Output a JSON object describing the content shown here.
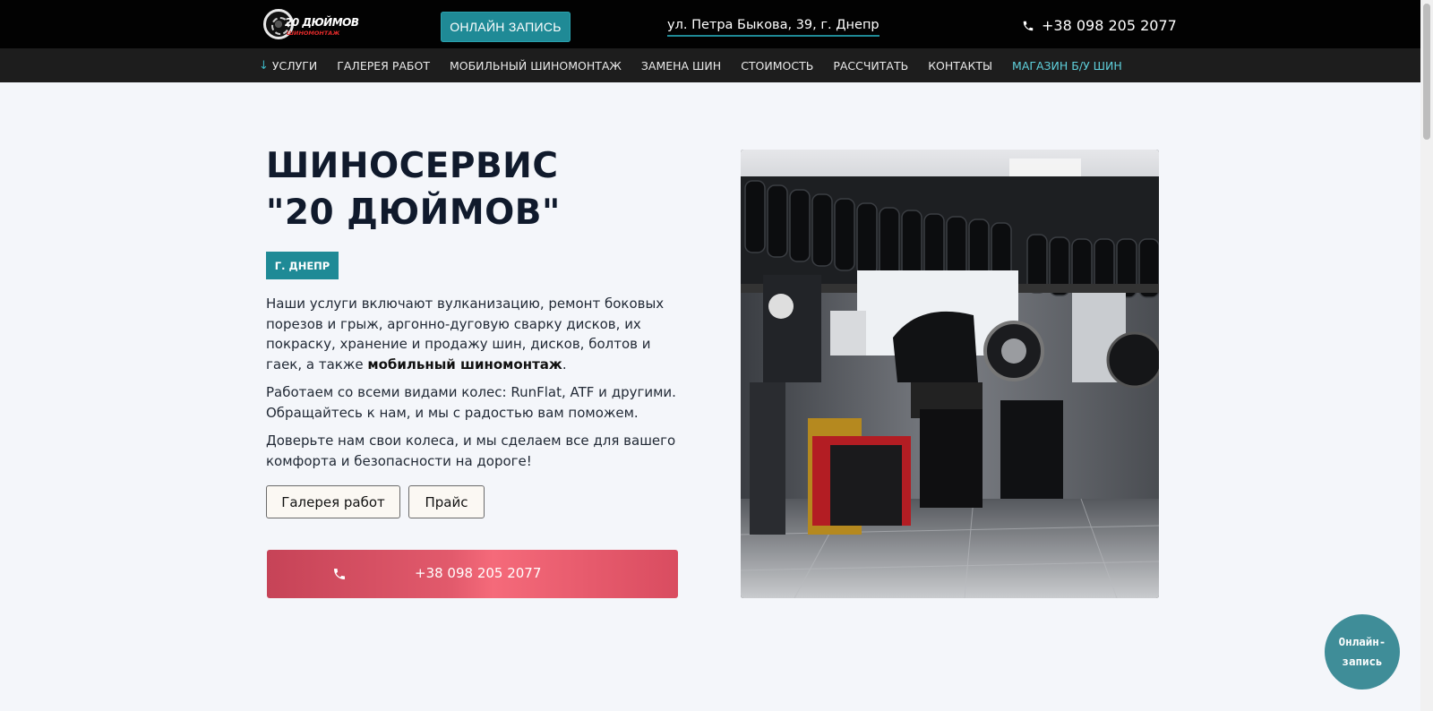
{
  "header": {
    "logo_line1": "20 ДЮЙМОВ",
    "logo_line2": "ШИНОМОНТАЖ",
    "book_button": "ОНЛАЙН ЗАПИСЬ",
    "address": "ул. Петра Быкова, 39, г. Днепр",
    "phone": "+38 098 205 2077",
    "accent_color": "#1f8a96"
  },
  "nav": {
    "items": [
      {
        "label": "УСЛУГИ",
        "icon": "arrow-down-icon"
      },
      {
        "label": "ГАЛЕРЕЯ РАБОТ"
      },
      {
        "label": "МОБИЛЬНЫЙ ШИНОМОНТАЖ"
      },
      {
        "label": "ЗАМЕНА ШИН"
      },
      {
        "label": "СТОИМОСТЬ"
      },
      {
        "label": "РАССЧИТАТЬ"
      },
      {
        "label": "КОНТАКТЫ"
      },
      {
        "label": "МАГАЗИН Б/У ШИН"
      }
    ]
  },
  "hero": {
    "title_line1": "ШИНОСЕРВИС",
    "title_line2": "\"20 ДЮЙМОВ\"",
    "badge": "Г. ДНЕПР",
    "p1_text": "Наши услуги включают вулканизацию, ремонт боковых порезов и грыж, аргонно-дуговую сварку дисков, их покраску, хранение и продажу шин, дисков, болтов и гаек, а также ",
    "p1_bold": "мобильный шиномонтаж",
    "p1_end": ".",
    "p2": "Работаем со всеми видами колес: RunFlat, ATF и другими. Обращайтесь к нам, и мы с радостью вам поможем.",
    "p3": "Доверьте нам свои колеса, и мы сделаем все для вашего комфорта и безопасности на дороге!",
    "gallery_button": "Галерея работ",
    "price_button": "Прайс",
    "phone_button": "+38 098 205 2077",
    "phone_color": "#e25a6c"
  },
  "floating": {
    "line1": "Онлайн-",
    "line2": "запись"
  }
}
